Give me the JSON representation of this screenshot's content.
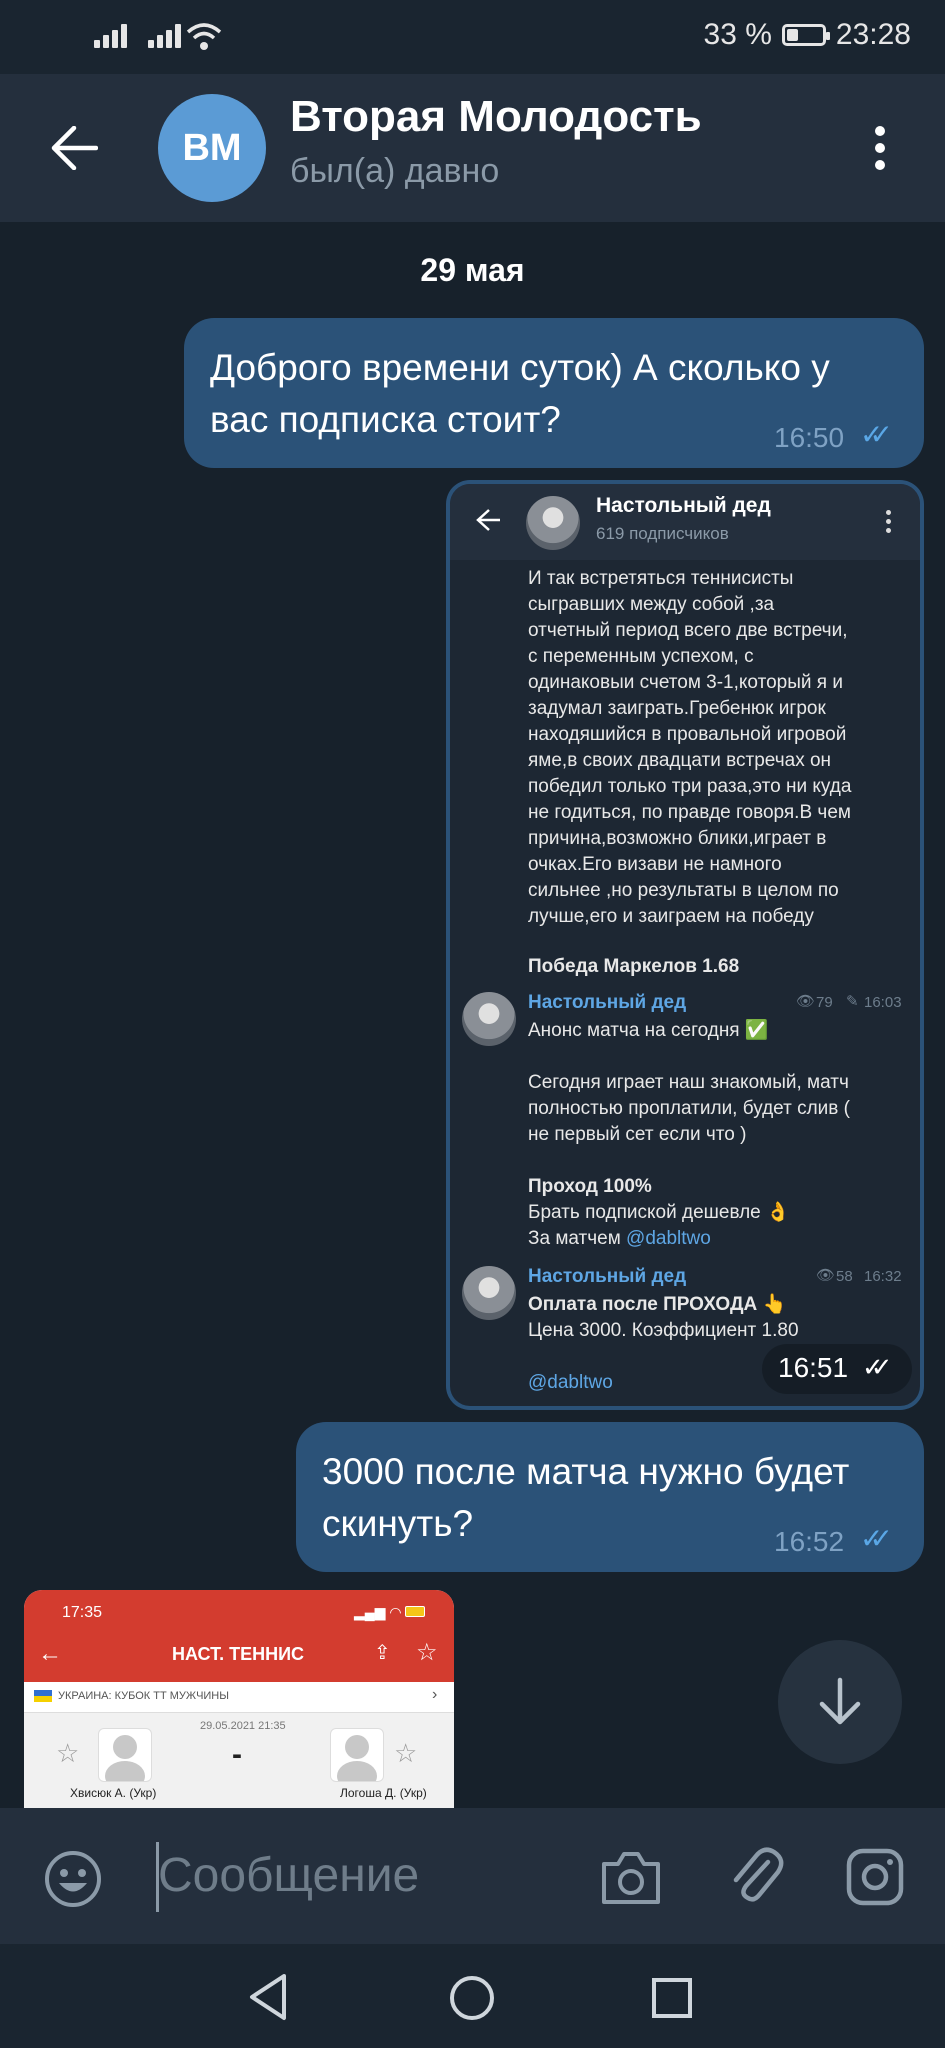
{
  "status": {
    "battery": "33 %",
    "time": "23:28"
  },
  "header": {
    "avatar_initials": "ВМ",
    "title": "Вторая Молодость",
    "subtitle": "был(а) давно"
  },
  "date_separator": "29 мая",
  "messages": [
    {
      "text_line1": "Доброго времени суток) А сколько у",
      "text_line2": "вас подписка стоит?",
      "time": "16:50"
    },
    {
      "time": "16:51"
    },
    {
      "text_line1": "3000 после матча нужно будет",
      "text_line2": "скинуть?",
      "time": "16:52"
    }
  ],
  "screenshot": {
    "channel_name": "Настольный дед",
    "subscribers": "619 подписчиков",
    "post_lines": [
      "И так встретяться теннисисты",
      "сыгравших между собой ,за",
      "отчетный период всего две встречи,",
      "с переменным успехом, с",
      "одинаковыи счетом 3-1,который я и",
      "задумал заиграть.Гребенюк игрок",
      "находяшийся в провальной игровой",
      "яме,в своих двадцати встречах он",
      "победил только три раза,это ни куда",
      "не годиться, по правде говоря.В чем",
      "причина,возможно блики,играет в",
      "очках.Его визави не намного",
      "сильнее ,но результаты в целом по",
      "лучше,его и заиграем на победу"
    ],
    "bet": "Победа Маркелов 1.68",
    "post2": {
      "name": "Настольный дед",
      "views": "79",
      "time": "16:03",
      "line1": "Анонс матча на сегодня ✅",
      "line2": "Сегодня играет наш знакомый, матч",
      "line3": "полностью проплатили, будет слив  (",
      "line4": "не первый сет если что )",
      "line5": "Проход 100%",
      "line6": "Брать подпиской дешевле 👌",
      "line7_prefix": "За матчем ",
      "line7_link": "@dabltwo"
    },
    "post3": {
      "name": "Настольный дед",
      "views": "58",
      "time": "16:32",
      "line1": "Оплата после ПРОХОДА 👆",
      "line2": "Цена 3000. Коэффициент 1.80",
      "link": "@dabltwo"
    }
  },
  "app_screenshot": {
    "time": "17:35",
    "title": "НАСТ. ТЕННИС",
    "league": "УКРАИНА: КУБОК ТТ МУЖЧИНЫ",
    "date": "29.05.2021 21:35",
    "score": "-",
    "player1": "Хвисюк А. (Укр)",
    "player2": "Логоша Д. (Укр)"
  },
  "input": {
    "placeholder": "Сообщение"
  },
  "colors": {
    "background": "#17212b",
    "header": "#242f3d",
    "bubble_out": "#2b5278",
    "accent": "#5aa7e6"
  }
}
